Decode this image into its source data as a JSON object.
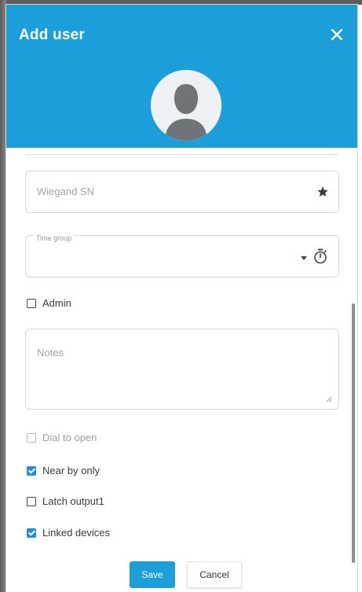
{
  "dialog": {
    "title": "Add user",
    "header_color": "#1b9ed9"
  },
  "icons": {
    "close": "close-icon",
    "avatar": "person-silhouette-icon",
    "star": "star-icon",
    "dropdown": "caret-down-icon",
    "timer": "stopwatch-icon",
    "resize": "resize-grip-icon"
  },
  "fields": {
    "wiegand": {
      "placeholder": "Wiegand SN",
      "value": ""
    },
    "time_group": {
      "label": "Time group",
      "value": ""
    },
    "notes": {
      "placeholder": "Notes",
      "value": ""
    }
  },
  "checkboxes": {
    "admin": {
      "label": "Admin",
      "checked": false
    },
    "dial_to_open": {
      "label": "Dial to open",
      "checked": false,
      "disabled": true
    },
    "near_by_only": {
      "label": "Near by only",
      "checked": true
    },
    "latch_output1": {
      "label": "Latch output1",
      "checked": false
    },
    "linked_devices": {
      "label": "Linked devices",
      "checked": true
    }
  },
  "buttons": {
    "save": "Save",
    "cancel": "Cancel"
  }
}
